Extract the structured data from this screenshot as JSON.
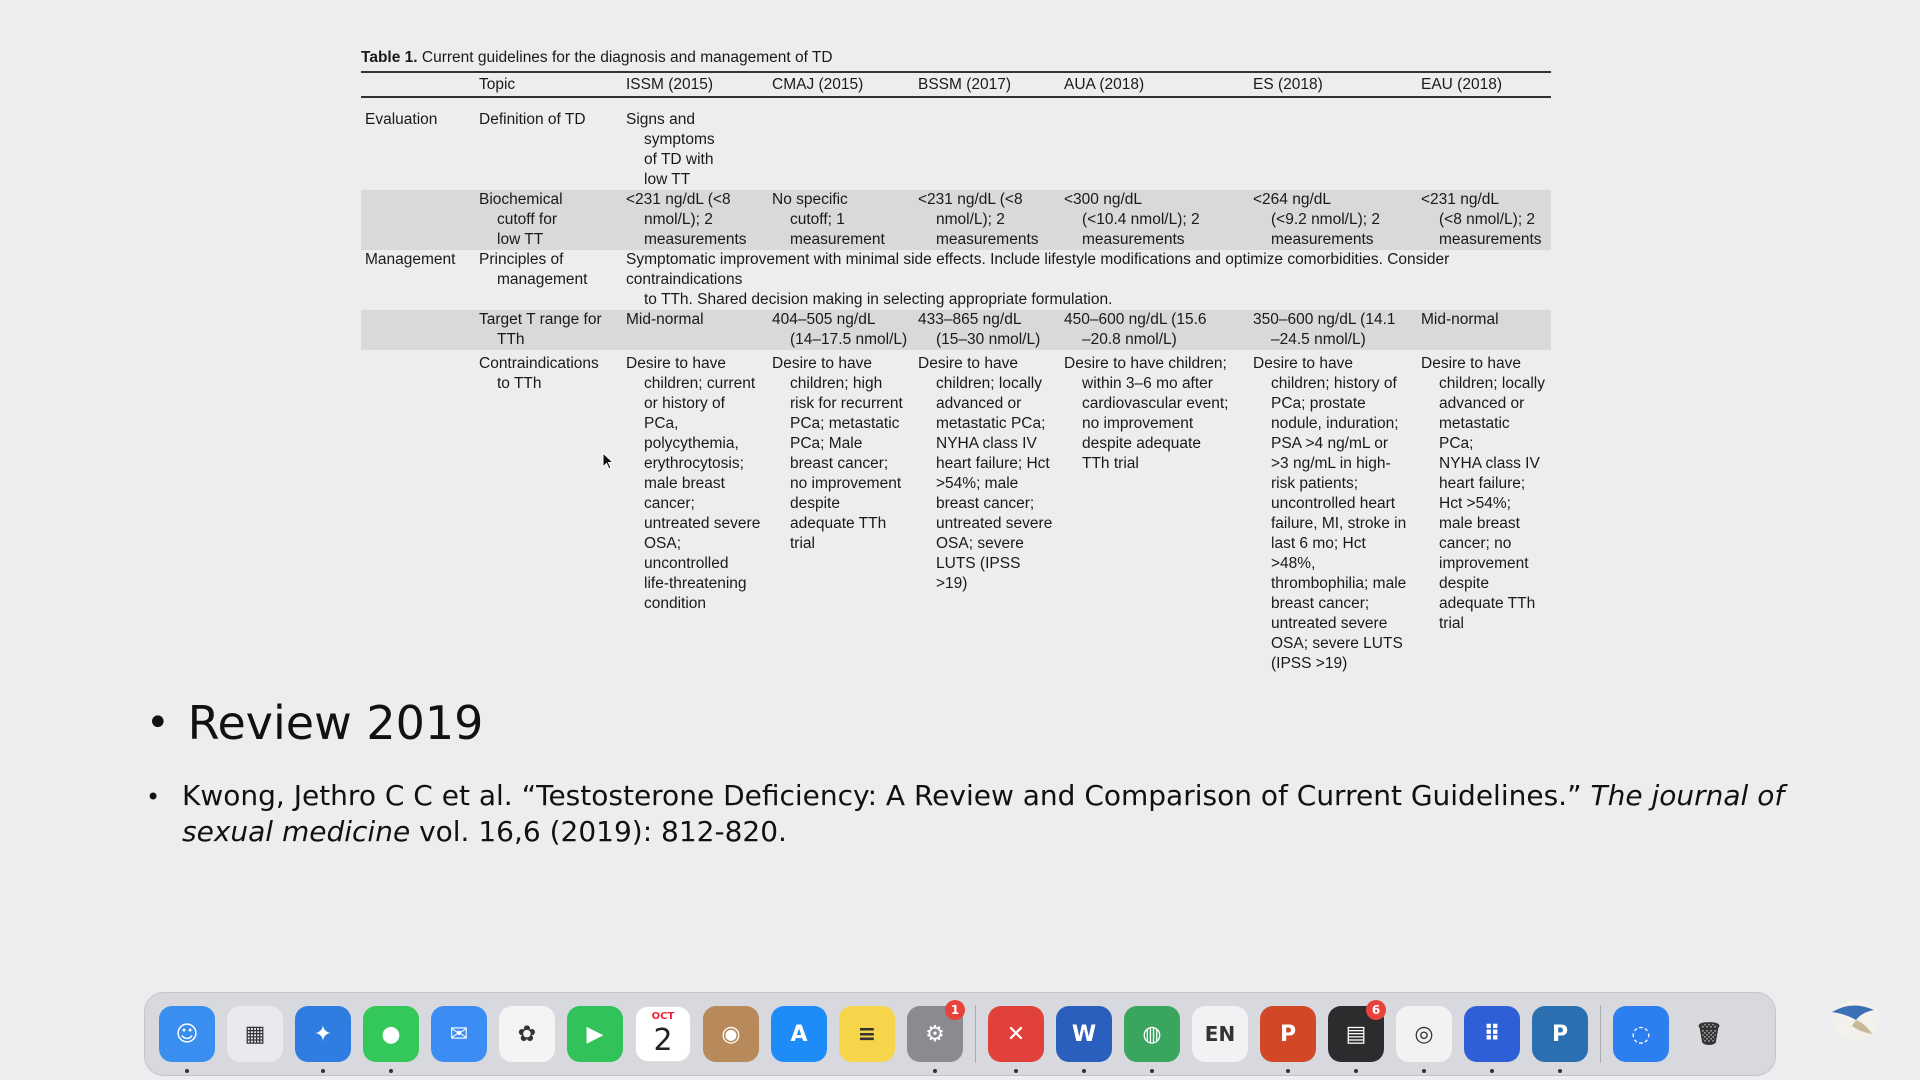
{
  "table": {
    "caption_bold": "Table 1.",
    "caption_rest": " Current guidelines for the diagnosis and management of TD",
    "headers": [
      "",
      "Topic",
      "ISSM (2015)",
      "CMAJ (2015)",
      "BSSM (2017)",
      "AUA (2018)",
      "ES (2018)",
      "EAU (2018)"
    ],
    "rows": [
      {
        "section": "Evaluation",
        "topic": [
          "Definition of TD"
        ],
        "cells": [
          [
            "Signs and",
            "symptoms",
            "of TD with",
            "low TT"
          ],
          [],
          [],
          [],
          [],
          []
        ]
      },
      {
        "section": "",
        "topic": [
          "Biochemical",
          "cutoff for",
          "low TT"
        ],
        "cells": [
          [
            "<231 ng/dL (<8",
            "nmol/L); 2",
            "measurements"
          ],
          [
            "No specific",
            "cutoff; 1",
            "measurement"
          ],
          [
            "<231 ng/dL (<8",
            "nmol/L); 2",
            "measurements"
          ],
          [
            "<300 ng/dL",
            "(<10.4 nmol/L); 2",
            "measurements"
          ],
          [
            "<264 ng/dL",
            "(<9.2 nmol/L); 2",
            "measurements"
          ],
          [
            "<231 ng/dL",
            "(<8 nmol/L); 2",
            "measurements"
          ]
        ]
      },
      {
        "section": "Management",
        "topic": [
          "Principles of",
          "management"
        ],
        "span_text": [
          "Symptomatic improvement with minimal side effects. Include lifestyle modifications and optimize comorbidities. Consider contraindications",
          "to TTh. Shared decision making in selecting appropriate formulation."
        ]
      },
      {
        "section": "",
        "topic": [
          "Target T range for",
          "TTh"
        ],
        "cells": [
          [
            "Mid-normal"
          ],
          [
            "404–505 ng/dL",
            "(14–17.5 nmol/L)"
          ],
          [
            "433–865 ng/dL",
            "(15–30 nmol/L)"
          ],
          [
            "450–600 ng/dL (15.6",
            "–20.8 nmol/L)"
          ],
          [
            "350–600 ng/dL (14.1",
            "–24.5 nmol/L)"
          ],
          [
            "Mid-normal"
          ]
        ]
      },
      {
        "section": "",
        "topic": [
          "Contraindications",
          "to TTh"
        ],
        "cells": [
          [
            "Desire to have",
            "children; current",
            "or history of",
            "PCa,",
            "polycythemia,",
            "erythrocytosis;",
            "male breast",
            "cancer;",
            "untreated severe",
            "OSA;",
            "uncontrolled",
            "life-threatening",
            "condition"
          ],
          [
            "Desire to have",
            "children; high",
            "risk for recurrent",
            "PCa; metastatic",
            "PCa; Male",
            "breast cancer;",
            "no improvement",
            "despite",
            "adequate TTh",
            "trial"
          ],
          [
            "Desire to have",
            "children; locally",
            "advanced or",
            "metastatic PCa;",
            "NYHA class IV",
            "heart failure; Hct",
            ">54%; male",
            "breast cancer;",
            "untreated severe",
            "OSA; severe",
            "LUTS (IPSS >19)"
          ],
          [
            "Desire to have children;",
            "within 3–6 mo after",
            "cardiovascular event;",
            "no improvement",
            "despite adequate",
            "TTh trial"
          ],
          [
            "Desire to have",
            "children; history of",
            "PCa; prostate",
            "nodule, induration;",
            "PSA >4 ng/mL or",
            ">3 ng/mL in high-",
            "risk patients;",
            "uncontrolled heart",
            "failure, MI, stroke in",
            "last 6 mo; Hct",
            ">48%,",
            "thrombophilia; male",
            "breast cancer;",
            "untreated severe",
            "OSA; severe LUTS",
            "(IPSS >19)"
          ],
          [
            "Desire to have",
            "children; locally",
            "advanced or",
            "metastatic PCa;",
            "NYHA class IV",
            "heart failure;",
            "Hct >54%;",
            "male breast",
            "cancer; no",
            "improvement",
            "despite",
            "adequate TTh",
            "trial"
          ]
        ]
      }
    ]
  },
  "bullets": {
    "main": "Review 2019",
    "ref_plain": "Kwong, Jethro C C et al. “Testosterone Deficiency: A Review and Comparison of Current Guidelines.” ",
    "ref_italic": "The journal of sexual medicine",
    "ref_tail": " vol. 16,6 (2019): 812-820."
  },
  "dock": {
    "items": [
      {
        "name": "finder",
        "icon": "finder-icon",
        "bg": "#3a8ef0",
        "glyph": "☺",
        "running": true
      },
      {
        "name": "launchpad",
        "icon": "launchpad-icon",
        "bg": "#e9e9ee",
        "glyph": "▦",
        "running": false
      },
      {
        "name": "safari",
        "icon": "compass-icon",
        "bg": "#2f7de1",
        "glyph": "✦",
        "running": true
      },
      {
        "name": "messages",
        "icon": "chat-bubble-icon",
        "bg": "#34c759",
        "glyph": "●",
        "running": true
      },
      {
        "name": "mail",
        "icon": "envelope-icon",
        "bg": "#3b8cf3",
        "glyph": "✉",
        "running": false
      },
      {
        "name": "photos",
        "icon": "flower-icon",
        "bg": "#f4f4f4",
        "glyph": "✿",
        "running": false
      },
      {
        "name": "facetime",
        "icon": "video-camera-icon",
        "bg": "#32c25a",
        "glyph": "▶",
        "running": false
      },
      {
        "name": "calendar",
        "icon": "calendar-icon",
        "bg": "#ffffff",
        "month": "OCT",
        "day": "2",
        "running": false
      },
      {
        "name": "contacts",
        "icon": "contact-card-icon",
        "bg": "#b8895a",
        "glyph": "◉",
        "running": false
      },
      {
        "name": "app-store",
        "icon": "app-store-icon",
        "bg": "#1d8cf8",
        "glyph": "A",
        "running": false
      },
      {
        "name": "notes",
        "icon": "notepad-icon",
        "bg": "#f6d54a",
        "glyph": "≡",
        "running": false
      },
      {
        "name": "system-settings",
        "icon": "gear-icon",
        "bg": "#8a8a8f",
        "glyph": "⚙",
        "badge": "1",
        "running": true
      },
      {
        "sep": true
      },
      {
        "name": "remote-desktop",
        "icon": "remote-desktop-icon",
        "bg": "#e0413a",
        "glyph": "✕",
        "running": true
      },
      {
        "name": "word",
        "icon": "word-icon",
        "bg": "#2b5fbd",
        "glyph": "W",
        "running": true
      },
      {
        "name": "globe-app",
        "icon": "globe-icon",
        "bg": "#3aa55e",
        "glyph": "◍",
        "running": true
      },
      {
        "name": "input-source",
        "icon": "keyboard-language-icon",
        "bg": "#f2f2f4",
        "glyph": "EN",
        "running": false
      },
      {
        "name": "powerpoint",
        "icon": "powerpoint-icon",
        "bg": "#d24726",
        "glyph": "P",
        "running": true
      },
      {
        "name": "printer-app",
        "icon": "printer-icon",
        "bg": "#2c2c2e",
        "glyph": "▤",
        "badge": "6",
        "running": true
      },
      {
        "name": "chrome",
        "icon": "chrome-icon",
        "bg": "#f2f2f2",
        "glyph": "◎",
        "running": true
      },
      {
        "name": "dialpad",
        "icon": "dialpad-icon",
        "bg": "#2f5fd7",
        "glyph": "⠿",
        "running": true
      },
      {
        "name": "power-app",
        "icon": "power-icon",
        "bg": "#2a6fb0",
        "glyph": "P",
        "running": true
      },
      {
        "sep": true
      },
      {
        "name": "airdrop",
        "icon": "airdrop-icon",
        "bg": "#2d7ff0",
        "glyph": "◌",
        "running": false
      },
      {
        "name": "trash",
        "icon": "trash-icon",
        "bg": "#d9dadd",
        "glyph": "🗑",
        "running": false
      }
    ]
  }
}
